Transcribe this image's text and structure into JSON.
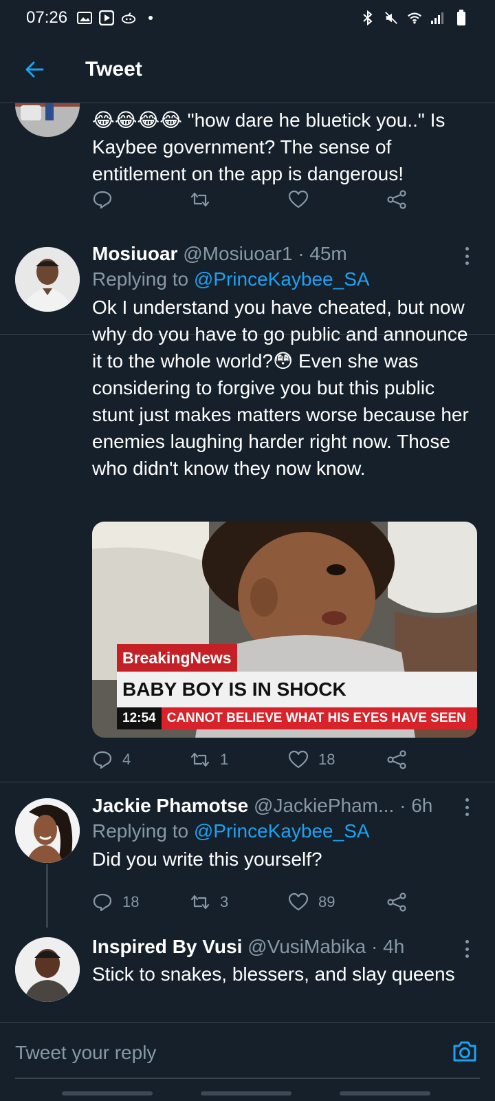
{
  "status_bar": {
    "time": "07:26"
  },
  "header": {
    "title": "Tweet"
  },
  "tweets": [
    {
      "text": "😂😂😂😂 \"how dare he bluetick you..\" Is Kaybee government? The sense of entitlement on the app is dangerous!",
      "actions": {
        "replies": "",
        "retweets": "",
        "likes": ""
      }
    },
    {
      "name": "Mosiuoar",
      "handle": "@Mosiuoar1",
      "time": "· 45m",
      "replying_label": "Replying to",
      "replying_to": "@PrinceKaybee_SA",
      "text": "Ok I understand you have cheated, but now why do you have to go public and announce it to the whole world?😳 Even she was considering to forgive you but this public stunt just makes matters worse because her enemies laughing harder right now. Those who didn't know they now know.",
      "media": {
        "badge": "BreakingNews",
        "headline": "BABY BOY IS IN SHOCK",
        "clock": "12:54",
        "ticker": "CANNOT BELIEVE WHAT HIS EYES HAVE SEEN"
      },
      "actions": {
        "replies": "4",
        "retweets": "1",
        "likes": "18"
      }
    },
    {
      "name": "Jackie Phamotse",
      "handle": "@JackiePham...",
      "time": "· 6h",
      "replying_label": "Replying to",
      "replying_to": "@PrinceKaybee_SA",
      "text": "Did you write this yourself?",
      "actions": {
        "replies": "18",
        "retweets": "3",
        "likes": "89"
      }
    },
    {
      "name": "Inspired By Vusi",
      "handle": "@VusiMabika",
      "time": "· 4h",
      "text": "Stick to snakes, blessers, and slay queens"
    }
  ],
  "reply_bar": {
    "placeholder": "Tweet your reply"
  },
  "colors": {
    "background": "#15202b",
    "accent": "#1da1f2",
    "muted": "#8899a6",
    "divider": "#38444d"
  },
  "icons": [
    "back-arrow-icon",
    "reply-icon",
    "retweet-icon",
    "like-icon",
    "share-icon",
    "more-icon",
    "camera-icon"
  ]
}
